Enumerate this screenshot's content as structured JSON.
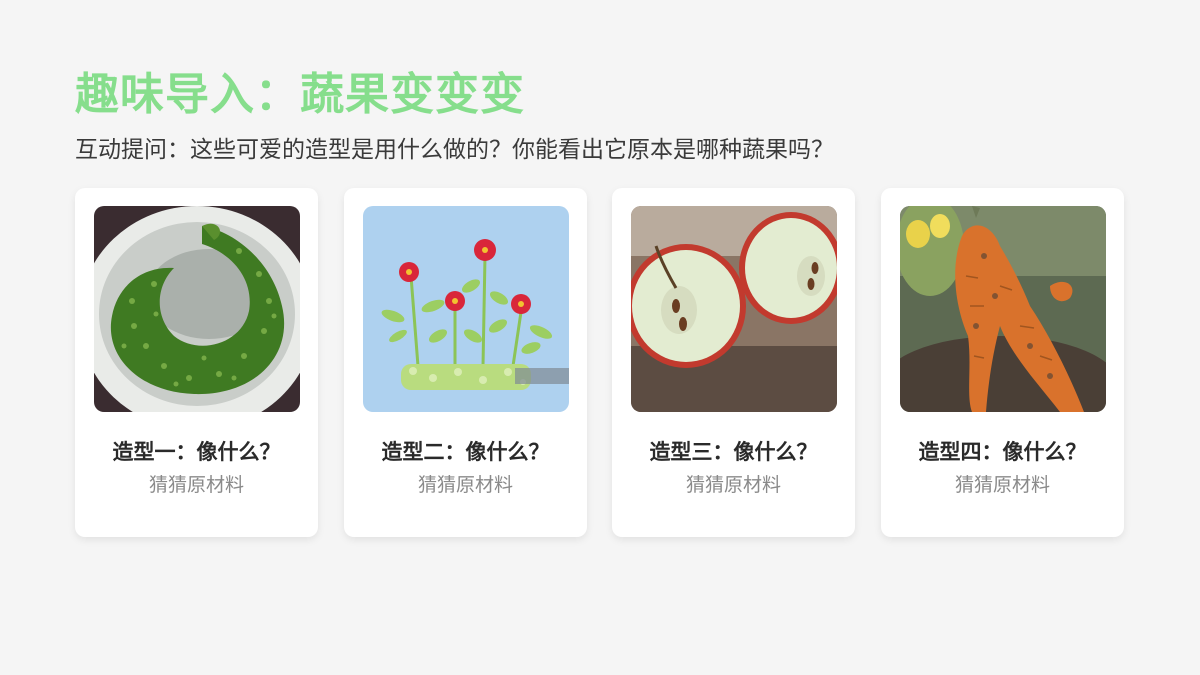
{
  "slide": {
    "title": "趣味导入：蔬果变变变",
    "subtitle": "互动提问：这些可爱的造型是用什么做的？你能看出它原本是哪种蔬果吗？"
  },
  "cards": [
    {
      "title": "造型一：像什么？",
      "hint": "猜猜原材料",
      "image": "curled-cucumber-in-white-bowl"
    },
    {
      "title": "造型二：像什么？",
      "hint": "猜猜原材料",
      "image": "flowers-made-of-celery-and-red-peppers"
    },
    {
      "title": "造型三：像什么？",
      "hint": "猜猜原材料",
      "image": "apple-halves-on-wooden-board"
    },
    {
      "title": "造型四：像什么？",
      "hint": "猜猜原材料",
      "image": "two-legged-carrot-in-soil"
    }
  ],
  "colors": {
    "title": "#86de8c",
    "background": "#f5f5f5",
    "card": "#ffffff"
  }
}
